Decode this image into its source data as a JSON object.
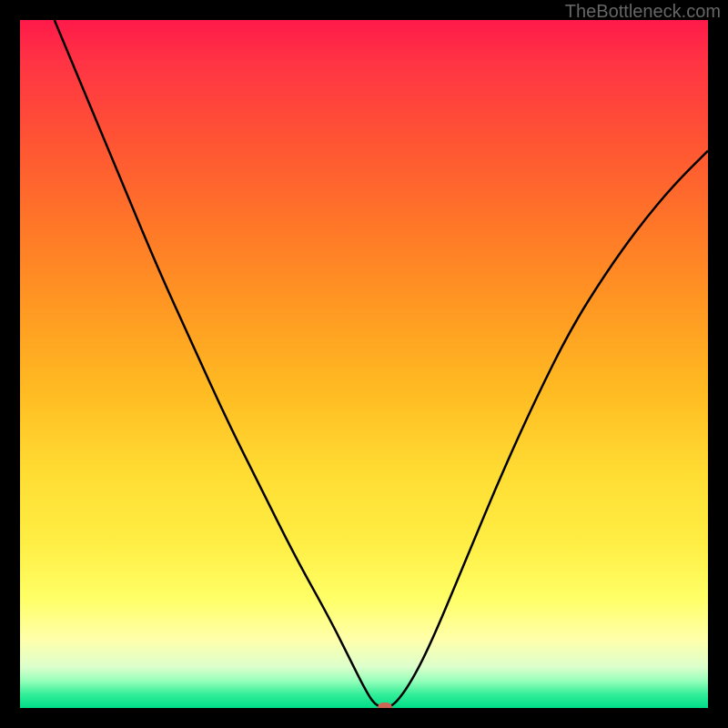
{
  "watermark": "TheBottleneck.com",
  "chart_data": {
    "type": "line",
    "title": "",
    "xlabel": "",
    "ylabel": "",
    "xlim": [
      0,
      100
    ],
    "ylim": [
      0,
      100
    ],
    "series": [
      {
        "name": "bottleneck-curve",
        "color": "#000000",
        "points": [
          {
            "x": 5,
            "y": 100
          },
          {
            "x": 10,
            "y": 88
          },
          {
            "x": 15,
            "y": 76
          },
          {
            "x": 20,
            "y": 64
          },
          {
            "x": 25,
            "y": 53
          },
          {
            "x": 30,
            "y": 42
          },
          {
            "x": 35,
            "y": 32
          },
          {
            "x": 40,
            "y": 22
          },
          {
            "x": 45,
            "y": 13
          },
          {
            "x": 48,
            "y": 7
          },
          {
            "x": 50,
            "y": 3
          },
          {
            "x": 51.5,
            "y": 0.5
          },
          {
            "x": 53,
            "y": 0
          },
          {
            "x": 54.5,
            "y": 0.5
          },
          {
            "x": 57,
            "y": 4
          },
          {
            "x": 60,
            "y": 10
          },
          {
            "x": 65,
            "y": 22
          },
          {
            "x": 70,
            "y": 34
          },
          {
            "x": 75,
            "y": 45
          },
          {
            "x": 80,
            "y": 55
          },
          {
            "x": 85,
            "y": 63
          },
          {
            "x": 90,
            "y": 70
          },
          {
            "x": 95,
            "y": 76
          },
          {
            "x": 100,
            "y": 81
          }
        ]
      }
    ],
    "marker": {
      "x": 53,
      "y": 0,
      "color": "#cc6655"
    }
  }
}
